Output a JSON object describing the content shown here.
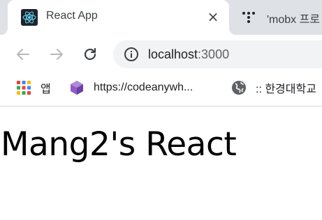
{
  "tabs": [
    {
      "title": "React App",
      "icon": "react-logo-icon",
      "active": true,
      "close_glyph": "×"
    },
    {
      "title": "'mobx 프로",
      "icon": "tab-dots-icon",
      "active": false
    }
  ],
  "toolbar": {
    "url_host": "localhost",
    "url_port": ":3000"
  },
  "bookmarks": [
    {
      "label": "앱",
      "icon": "apps-grid-icon"
    },
    {
      "label": "https://codeanywh...",
      "icon": "codeanywhere-cube-icon"
    },
    {
      "label": ":: 한경대학교",
      "icon": "globe-icon"
    }
  ],
  "page": {
    "heading": "Mang2's React"
  },
  "colors": {
    "tabstrip_bg": "#dee1e6",
    "omnibox_bg": "#f1f3f4",
    "react_blue": "#61dafb",
    "text_primary": "#202124",
    "text_secondary": "#5f6368"
  }
}
